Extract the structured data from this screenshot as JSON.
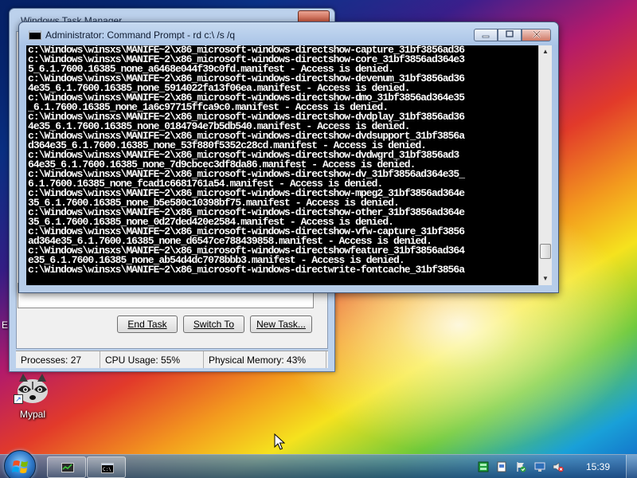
{
  "task_manager": {
    "title": "Windows Task Manager",
    "buttons": {
      "end_task": "End Task",
      "switch_to": "Switch To",
      "new_task": "New Task..."
    },
    "status": {
      "processes": "Processes: 27",
      "cpu": "CPU Usage: 55%",
      "memory": "Physical Memory: 43%"
    }
  },
  "cmd": {
    "title": "Administrator: Command Prompt - rd  c:\\ /s /q",
    "lines": [
      "c:\\Windows\\winsxs\\MANIFE~2\\x86_microsoft-windows-directshow-capture_31bf3856ad36",
      "c:\\Windows\\winsxs\\MANIFE~2\\x86_microsoft-windows-directshow-core_31bf3856ad364e3",
      "5_6.1.7600.16385_none_a6468e044f39c0fd.manifest - Access is denied.",
      "c:\\Windows\\winsxs\\MANIFE~2\\x86_microsoft-windows-directshow-devenum_31bf3856ad36",
      "4e35_6.1.7600.16385_none_5914022fa13f06ea.manifest - Access is denied.",
      "c:\\Windows\\winsxs\\MANIFE~2\\x86_microsoft-windows-directshow-dmo_31bf3856ad364e35",
      "_6.1.7600.16385_none_1a6c97715ffca9c0.manifest - Access is denied.",
      "c:\\Windows\\winsxs\\MANIFE~2\\x86_microsoft-windows-directshow-dvdplay_31bf3856ad36",
      "4e35_6.1.7600.16385_none_0184794e7b5db540.manifest - Access is denied.",
      "c:\\Windows\\winsxs\\MANIFE~2\\x86_microsoft-windows-directshow-dvdsupport_31bf3856a",
      "d364e35_6.1.7600.16385_none_53f880f5352c28cd.manifest - Access is denied.",
      "c:\\Windows\\winsxs\\MANIFE~2\\x86_microsoft-windows-directshow-dvdwgrd_31bf3856ad3",
      "64e35_6.1.7600.16385_none_7d9cbcec3df8da86.manifest - Access is denied.",
      "c:\\Windows\\winsxs\\MANIFE~2\\x86_microsoft-windows-directshow-dv_31bf3856ad364e35_",
      "6.1.7600.16385_none_fcad1c6681761a54.manifest - Access is denied.",
      "c:\\Windows\\winsxs\\MANIFE~2\\x86_microsoft-windows-directshow-mpeg2_31bf3856ad364e",
      "35_6.1.7600.16385_none_b5e580c10398bf75.manifest - Access is denied.",
      "c:\\Windows\\winsxs\\MANIFE~2\\x86_microsoft-windows-directshow-other_31bf3856ad364e",
      "35_6.1.7600.16385_none_0d27ded420e2584.manifest - Access is denied.",
      "c:\\Windows\\winsxs\\MANIFE~2\\x86_microsoft-windows-directshow-vfw-capture_31bf3856",
      "ad364e35_6.1.7600.16385_none_d6547ce788439858.manifest - Access is denied.",
      "c:\\Windows\\winsxs\\MANIFE~2\\x86_microsoft-windows-directshowfeature_31bf3856ad364",
      "e35_6.1.7600.16385_none_ab54d4dc7078bbb3.manifest - Access is denied.",
      "c:\\Windows\\winsxs\\MANIFE~2\\x86_microsoft-windows-directwrite-fontcache_31bf3856a"
    ],
    "scroll_position": 0.93
  },
  "desktop": {
    "icon_label": "Mypal",
    "edge_text": "E"
  },
  "taskbar": {
    "clock": "15:39"
  }
}
